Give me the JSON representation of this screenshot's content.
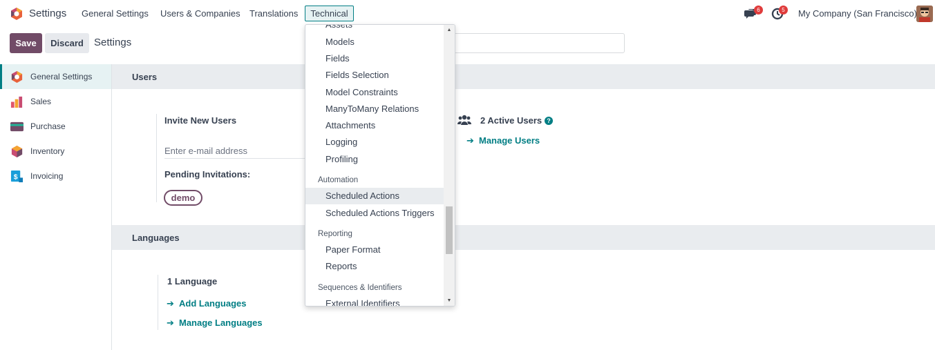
{
  "navbar": {
    "app_title": "Settings",
    "menus": [
      "General Settings",
      "Users & Companies",
      "Translations",
      "Technical"
    ],
    "messages_badge": "6",
    "activities_badge": "5",
    "company": "My Company (San Francisco)"
  },
  "control_panel": {
    "save": "Save",
    "discard": "Discard",
    "breadcrumb": "Settings"
  },
  "sidebar": {
    "items": [
      {
        "label": "General Settings",
        "icon": "settings-icon"
      },
      {
        "label": "Sales",
        "icon": "sales-icon"
      },
      {
        "label": "Purchase",
        "icon": "purchase-icon"
      },
      {
        "label": "Inventory",
        "icon": "inventory-icon"
      },
      {
        "label": "Invoicing",
        "icon": "invoicing-icon"
      }
    ]
  },
  "users_section": {
    "title": "Users",
    "invite_label": "Invite New Users",
    "email_placeholder": "Enter e-mail address",
    "pending_label": "Pending Invitations:",
    "pending_tag": "demo",
    "active_users": "2 Active Users",
    "manage_users": "Manage Users"
  },
  "languages_section": {
    "title": "Languages",
    "count": "1 Language",
    "add": "Add Languages",
    "manage": "Manage Languages"
  },
  "dropdown": {
    "items_top": [
      "Assets",
      "Models",
      "Fields",
      "Fields Selection",
      "Model Constraints",
      "ManyToMany Relations",
      "Attachments",
      "Logging",
      "Profiling"
    ],
    "automation_header": "Automation",
    "automation_items": [
      "Scheduled Actions",
      "Scheduled Actions Triggers"
    ],
    "reporting_header": "Reporting",
    "reporting_items": [
      "Paper Format",
      "Reports"
    ],
    "sequences_header": "Sequences & Identifiers",
    "sequences_items": [
      "External Identifiers"
    ]
  },
  "colors": {
    "brand": "#714b67",
    "accent": "#017e84",
    "badge": "#e03c3c"
  }
}
